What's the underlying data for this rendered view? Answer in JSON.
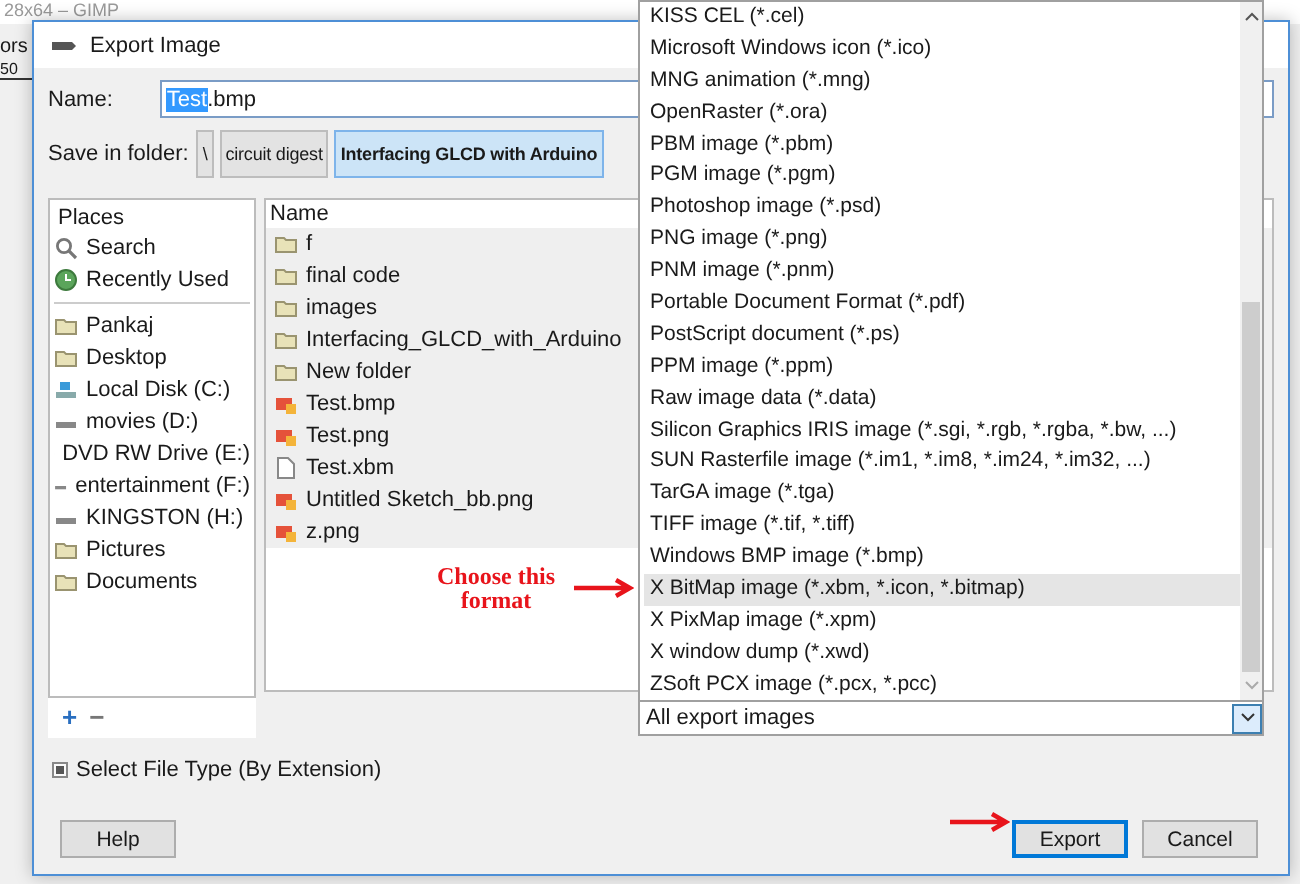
{
  "background_window": {
    "title": "28x64 – GIMP",
    "menu_fragment": "ors",
    "ruler_fragment": "50"
  },
  "dialog": {
    "title": "Export Image"
  },
  "name": {
    "label": "Name:",
    "selected_text": "Test",
    "rest_text": ".bmp"
  },
  "folder": {
    "label": "Save in folder:",
    "path": [
      {
        "label": "\\",
        "selected": false
      },
      {
        "label": "circuit digest",
        "selected": false
      },
      {
        "label": "Interfacing GLCD with Arduino",
        "selected": true
      }
    ]
  },
  "places": {
    "header": "Places",
    "system": [
      {
        "kind": "search",
        "label": "Search"
      },
      {
        "kind": "recent",
        "label": "Recently Used"
      }
    ],
    "bookmarks": [
      {
        "kind": "folder",
        "label": "Pankaj"
      },
      {
        "kind": "folder",
        "label": "Desktop"
      },
      {
        "kind": "disk",
        "label": "Local Disk (C:)"
      },
      {
        "kind": "drive",
        "label": "movies (D:)"
      },
      {
        "kind": "dvd",
        "label": "DVD RW Drive (E:)"
      },
      {
        "kind": "drive",
        "label": "entertainment (F:)"
      },
      {
        "kind": "drive",
        "label": "KINGSTON (H:)"
      },
      {
        "kind": "folder",
        "label": "Pictures"
      },
      {
        "kind": "folder",
        "label": "Documents"
      }
    ],
    "add": "+",
    "remove": "−"
  },
  "files": {
    "header": "Name",
    "rows": [
      {
        "kind": "folder",
        "label": "f"
      },
      {
        "kind": "folder",
        "label": "final code"
      },
      {
        "kind": "folder",
        "label": "images"
      },
      {
        "kind": "folder",
        "label": "Interfacing_GLCD_with_Arduino"
      },
      {
        "kind": "folder",
        "label": "New folder"
      },
      {
        "kind": "image",
        "label": "Test.bmp"
      },
      {
        "kind": "image",
        "label": "Test.png"
      },
      {
        "kind": "file",
        "label": "Test.xbm"
      },
      {
        "kind": "image",
        "label": "Untitled Sketch_bb.png"
      },
      {
        "kind": "image",
        "label": "z.png"
      }
    ]
  },
  "file_type_list": {
    "items": [
      {
        "label": "KISS CEL (*.cel)",
        "selected": false
      },
      {
        "label": "Microsoft Windows icon (*.ico)",
        "selected": false
      },
      {
        "label": "MNG animation (*.mng)",
        "selected": false
      },
      {
        "label": "OpenRaster (*.ora)",
        "selected": false
      },
      {
        "label": "PBM image (*.pbm)",
        "selected": false
      },
      {
        "label": "PGM image (*.pgm)",
        "selected": false
      },
      {
        "label": "Photoshop image (*.psd)",
        "selected": false
      },
      {
        "label": "PNG image (*.png)",
        "selected": false
      },
      {
        "label": "PNM image (*.pnm)",
        "selected": false
      },
      {
        "label": "Portable Document Format (*.pdf)",
        "selected": false
      },
      {
        "label": "PostScript document (*.ps)",
        "selected": false
      },
      {
        "label": "PPM image (*.ppm)",
        "selected": false
      },
      {
        "label": "Raw image data (*.data)",
        "selected": false
      },
      {
        "label": "Silicon Graphics IRIS image (*.sgi, *.rgb, *.rgba, *.bw, ...)",
        "selected": false
      },
      {
        "label": "SUN Rasterfile image (*.im1, *.im8, *.im24, *.im32, ...)",
        "selected": false
      },
      {
        "label": "TarGA image (*.tga)",
        "selected": false
      },
      {
        "label": "TIFF image (*.tif, *.tiff)",
        "selected": false
      },
      {
        "label": "Windows BMP image (*.bmp)",
        "selected": false
      },
      {
        "label": "X BitMap image (*.xbm, *.icon, *.bitmap)",
        "selected": true
      },
      {
        "label": "X PixMap image (*.xpm)",
        "selected": false
      },
      {
        "label": "X window dump (*.xwd)",
        "selected": false
      },
      {
        "label": "ZSoft PCX image (*.pcx, *.pcc)",
        "selected": false
      }
    ],
    "combo_value": "All export images"
  },
  "select_file_type": {
    "label": "Select File Type (By Extension)",
    "expanded": false
  },
  "annotation": {
    "text": "Choose this format"
  },
  "buttons": {
    "help": "Help",
    "export": "Export",
    "cancel": "Cancel"
  }
}
